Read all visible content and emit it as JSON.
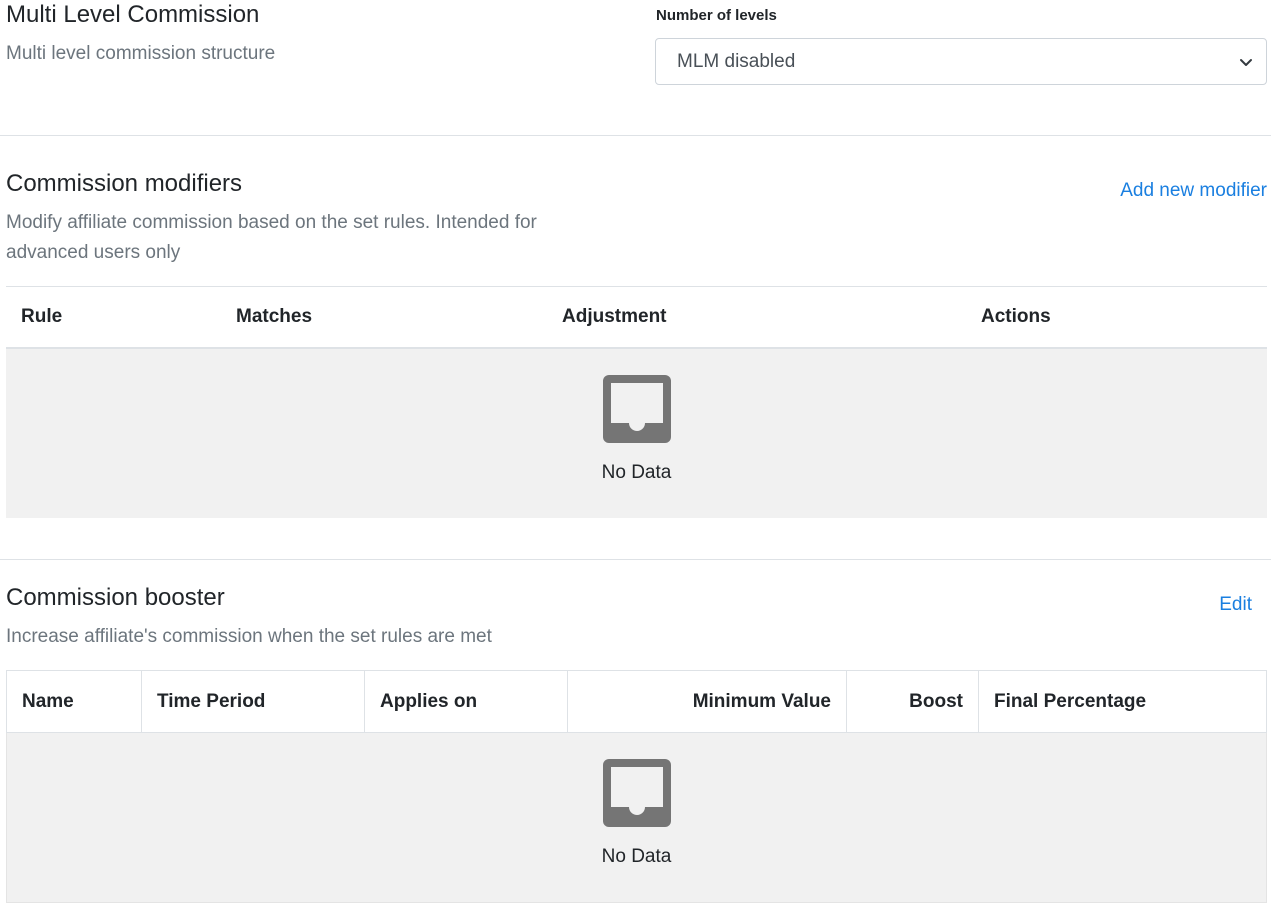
{
  "mlm": {
    "title": "Multi Level Commission",
    "subtitle": "Multi level commission structure",
    "levels_label": "Number of levels",
    "levels_value": "MLM disabled"
  },
  "modifiers": {
    "title": "Commission modifiers",
    "subtitle_line1": "Modify affiliate commission based on the set rules. Intended for",
    "subtitle_line2": "advanced users only",
    "add_link": "Add new modifier",
    "columns": [
      "Rule",
      "Matches",
      "Adjustment",
      "Actions"
    ],
    "empty_text": "No Data"
  },
  "booster": {
    "title": "Commission booster",
    "subtitle": "Increase affiliate's commission when the set rules are met",
    "edit_link": "Edit",
    "columns": [
      "Name",
      "Time Period",
      "Applies on",
      "Minimum Value",
      "Boost",
      "Final Percentage"
    ],
    "empty_text": "No Data"
  },
  "icons": {
    "select_arrow": "chevron-down-icon",
    "empty": "empty-inbox-icon"
  },
  "colors": {
    "link": "#1a7fe0",
    "muted_text": "#6c757d",
    "empty_bg": "#f1f1f1",
    "empty_icon": "#757575"
  }
}
